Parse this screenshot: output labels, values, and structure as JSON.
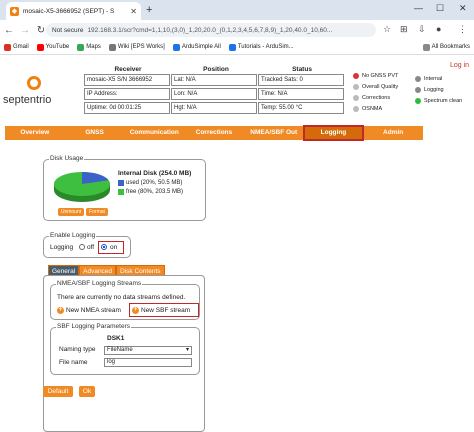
{
  "browser": {
    "tab_title": "mosaic-X5-3666952 (SEPT) - S",
    "url_security": "Not secure",
    "url": "192.168.3.1/scr?cmd=1,1,10,(3,0)_1,20,20.0_(0,1,2,3,4,5,6,7,8,9)_1,20,40.0_10,60...",
    "bookmarks": [
      "Gmail",
      "YouTube",
      "Maps",
      "Wiki [EPS Works]",
      "ArduSimple All",
      "Tutorials - ArduSim...",
      "All Bookmarks"
    ]
  },
  "header": {
    "brand": "septentrio",
    "login": "Log in",
    "col_receiver": "Receiver",
    "col_position": "Position",
    "col_status": "Status",
    "receiver": [
      "mosaic-X5 S/N 3666952",
      "IP Address:",
      "Uptime: 0d 00:01:25"
    ],
    "position": [
      "Lat: N/A",
      "Lon: N/A",
      "Hgt: N/A"
    ],
    "status": [
      "Tracked Sats: 0",
      "Time: N/A",
      "Temp: 55.00 °C"
    ],
    "legend_left": [
      "No GNSS PVT",
      "Overall Quality",
      "Corrections",
      "OSNMA"
    ],
    "legend_right": [
      "Internal",
      "Logging",
      "Spectrum clean"
    ]
  },
  "nav": [
    "Overview",
    "GNSS",
    "Communication",
    "Corrections",
    "NMEA/SBF Out",
    "Logging",
    "Admin"
  ],
  "disk": {
    "legend": "Disk Usage",
    "title": "Internal Disk (254.0 MB)",
    "used": "used (20%, 50.5 MB)",
    "free": "free (80%, 203.5 MB)",
    "used_fraction": 0.2,
    "btn_unmount": "Unmount",
    "btn_format": "Format"
  },
  "enable": {
    "legend": "Enable Logging",
    "label": "Logging",
    "off": "off",
    "on": "on"
  },
  "subtabs": [
    "General",
    "Advanced",
    "Disk Contents"
  ],
  "streams": {
    "legend": "NMEA/SBF Logging Streams",
    "msg": "There are currently no data streams defined.",
    "new_nmea": "New NMEA stream",
    "new_sbf": "New SBF stream"
  },
  "params": {
    "legend": "SBF Logging Parameters",
    "disk": "DSK1",
    "naming_label": "Naming type",
    "naming_value": "FileName",
    "file_label": "File name",
    "file_value": "log"
  },
  "actions": {
    "default": "Default",
    "ok": "Ok"
  },
  "colors": {
    "orange": "#f08a24",
    "used": "#3a63c8",
    "free": "#3fbf3f",
    "highlight": "#c0292b"
  }
}
